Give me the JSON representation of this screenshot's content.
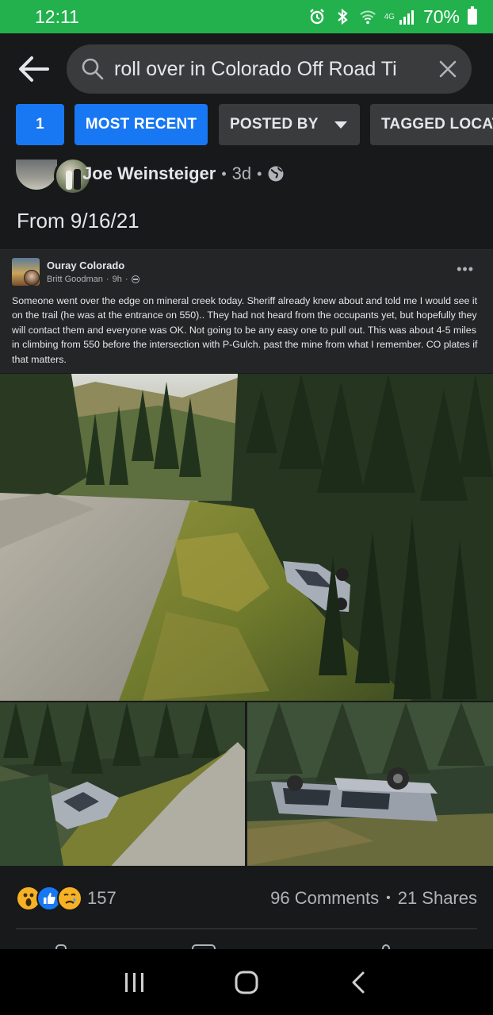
{
  "status_bar": {
    "time": "12:11",
    "network": "4G",
    "battery": "70%",
    "icons": [
      "alarm-icon",
      "bluetooth-icon",
      "wifi-icon",
      "signal-icon",
      "battery-icon"
    ]
  },
  "search": {
    "query": "roll over in Colorado Off Road Ti",
    "icons": [
      "back-arrow-icon",
      "search-icon",
      "close-icon"
    ]
  },
  "filters": {
    "count": "1",
    "most_recent": "MOST RECENT",
    "posted_by": "POSTED BY",
    "tagged_location": "TAGGED LOCATION"
  },
  "post": {
    "author": "Joe Weinsteiger",
    "time": "3d",
    "privacy_icon": "globe-icon",
    "text": "From 9/16/21",
    "shared": {
      "group": "Ouray Colorado",
      "author": "Britt Goodman",
      "time": "9h",
      "body": "Someone went over the edge on mineral creek today. Sheriff already knew about and told me I would see it on the trail (he was at the entrance on 550).. They had not heard from the occupants yet, but hopefully they will contact them and everyone was OK.  Not going to be any easy one to pull out. This was about 4-5 miles in climbing from 550 before the intersection with P-Gulch. past the mine from what I remember. CO plates if that matters."
    },
    "reactions": {
      "count": "157",
      "types": [
        "wow",
        "like",
        "sad"
      ]
    },
    "comments": "96 Comments",
    "shares": "21 Shares"
  },
  "colors": {
    "status_bar": "#22b14c",
    "background": "#18191a",
    "chip_blue": "#1877f2",
    "chip_dark": "#3a3b3c",
    "text_primary": "#e4e6eb",
    "text_secondary": "#b0b3b8"
  }
}
